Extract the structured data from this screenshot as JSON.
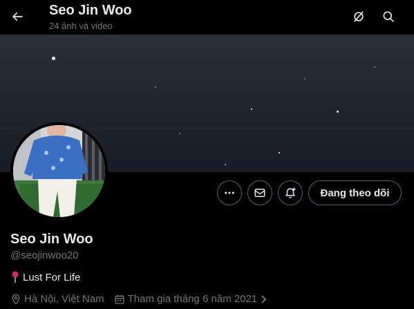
{
  "header": {
    "title": "Seo Jin Woo",
    "subtitle": "24 ảnh và video",
    "back_icon": "arrow-left-icon",
    "icons": [
      "grok-icon",
      "search-icon"
    ]
  },
  "profile": {
    "name": "Seo Jin Woo",
    "handle": "@seojinwoo20",
    "bio_icon": "round-pushpin",
    "bio": "Lust For Life",
    "location": "Hà Nội, Việt Nam",
    "joined": "Tham gia tháng 6 năm 2021"
  },
  "actions": {
    "more_icon": "more-icon",
    "message_icon": "mail-icon",
    "notify_icon": "bell-plus-icon",
    "follow_label": "Đang theo dõi"
  },
  "colors": {
    "background": "#000000",
    "text_primary": "#e7e9ea",
    "text_secondary": "#71767b",
    "border": "#536471",
    "pin": "#f91880"
  }
}
